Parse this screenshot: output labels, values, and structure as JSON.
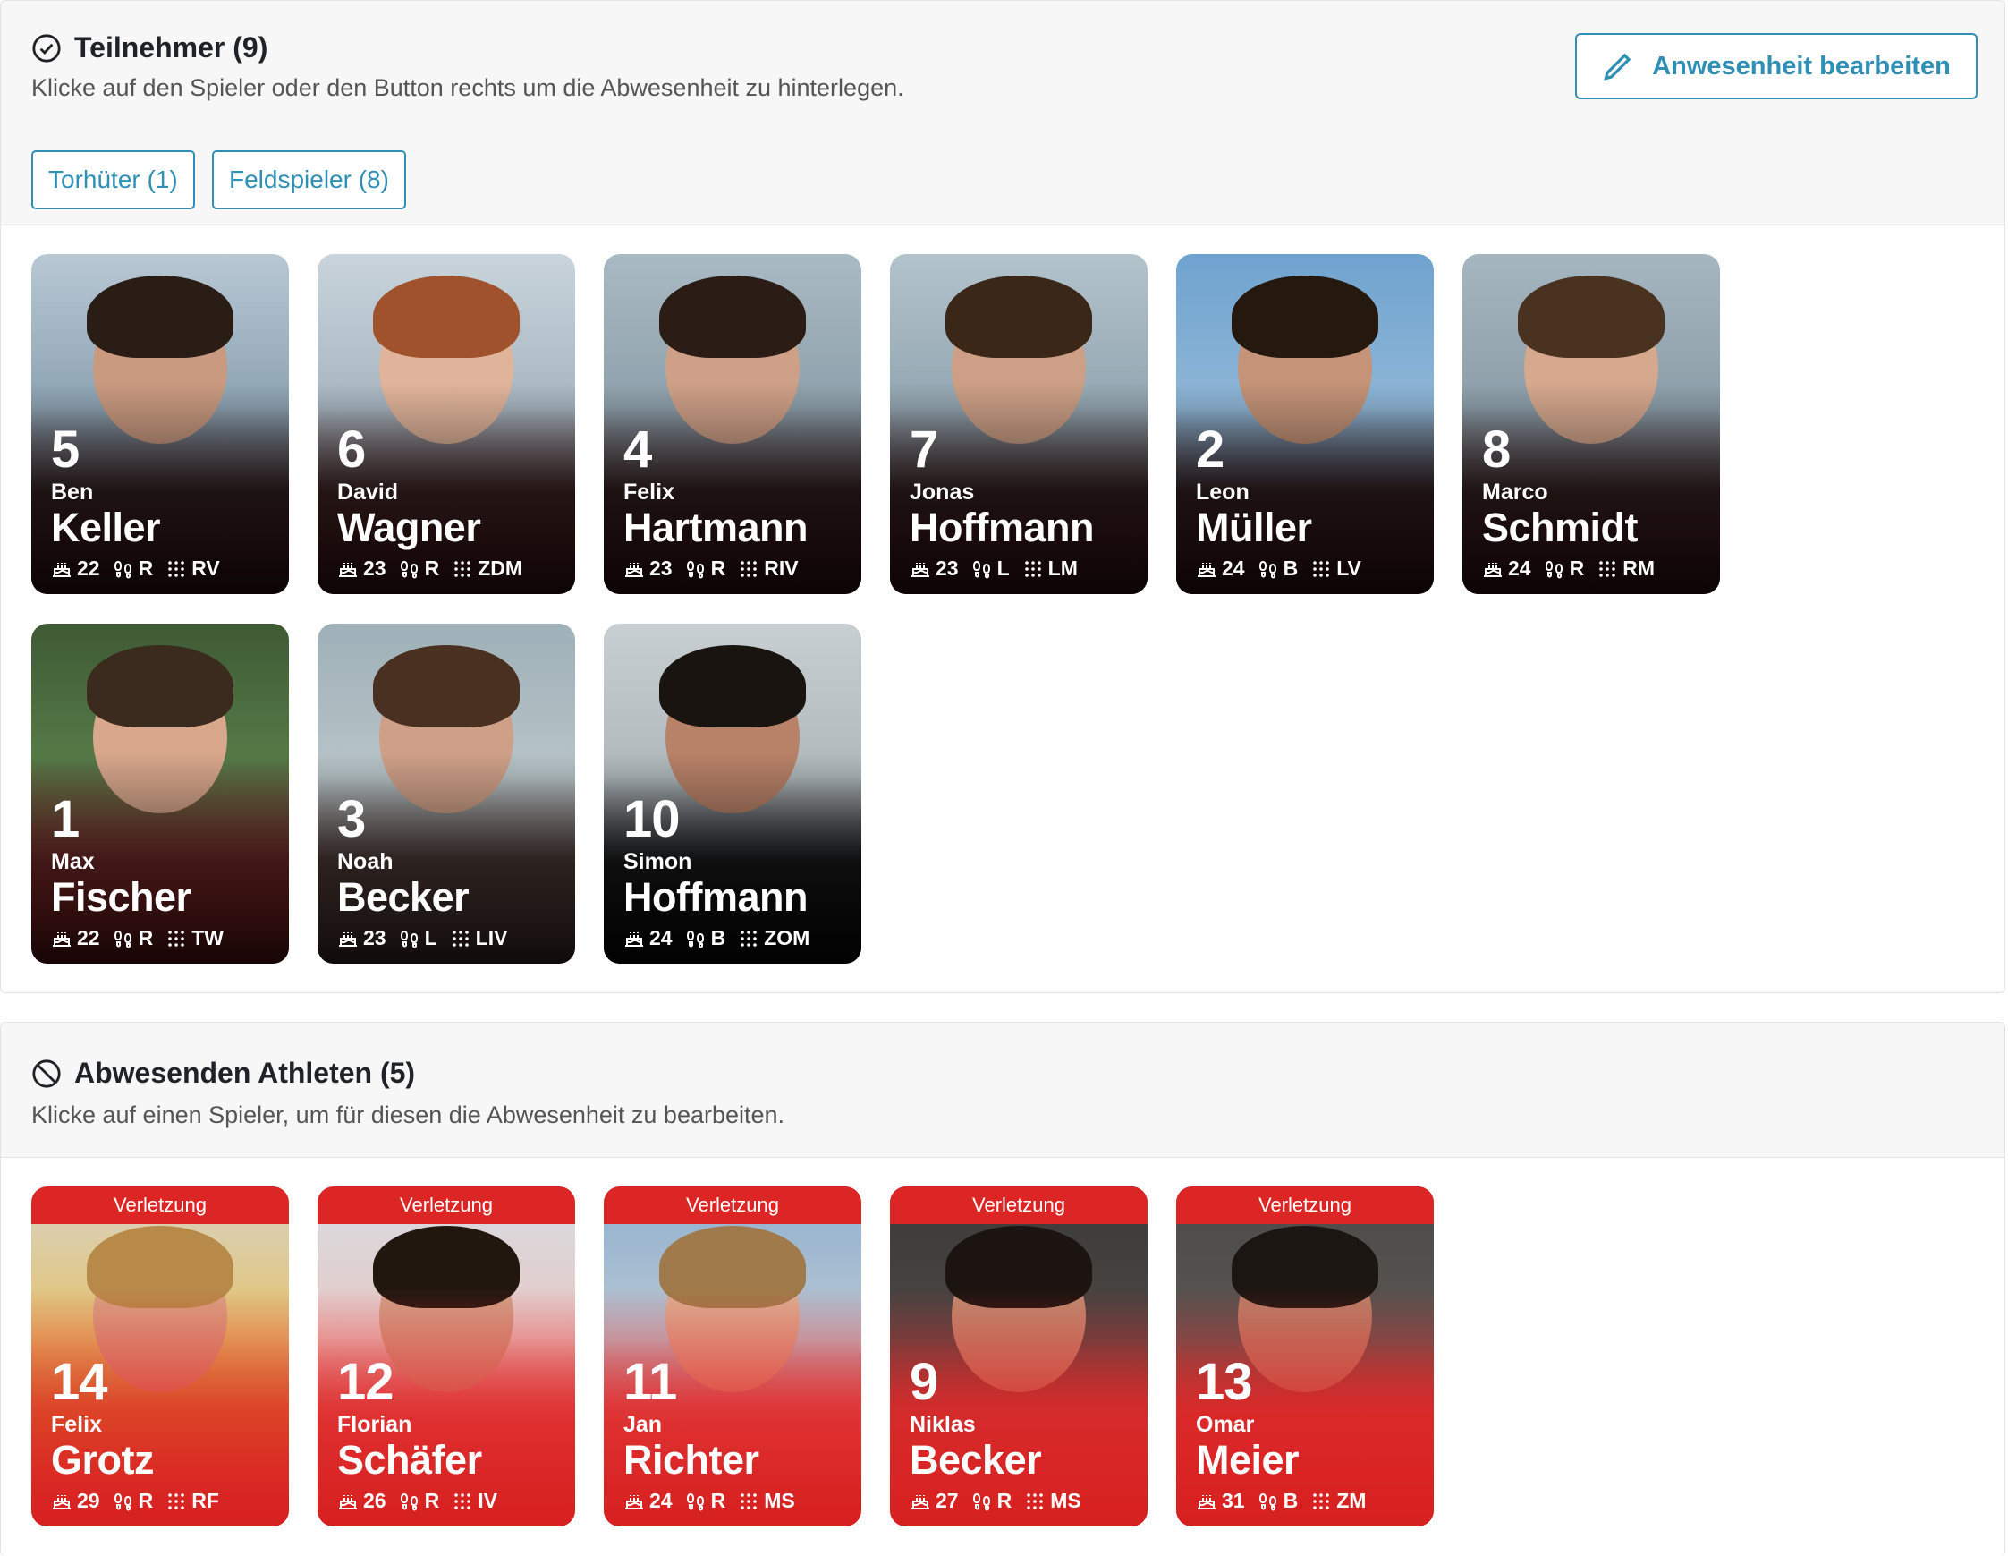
{
  "participants": {
    "title": "Teilnehmer (9)",
    "subtitle": "Klicke auf den Spieler oder den Button rechts um die Abwesenheit zu hinterlegen.",
    "edit_button": "Anwesenheit bearbeiten",
    "filters": [
      "Torhüter (1)",
      "Feldspieler (8)"
    ],
    "players": [
      {
        "number": "5",
        "first": "Ben",
        "last": "Keller",
        "age": "22",
        "foot": "R",
        "pos": "RV"
      },
      {
        "number": "6",
        "first": "David",
        "last": "Wagner",
        "age": "23",
        "foot": "R",
        "pos": "ZDM"
      },
      {
        "number": "4",
        "first": "Felix",
        "last": "Hartmann",
        "age": "23",
        "foot": "R",
        "pos": "RIV"
      },
      {
        "number": "7",
        "first": "Jonas",
        "last": "Hoffmann",
        "age": "23",
        "foot": "L",
        "pos": "LM"
      },
      {
        "number": "2",
        "first": "Leon",
        "last": "Müller",
        "age": "24",
        "foot": "B",
        "pos": "LV"
      },
      {
        "number": "8",
        "first": "Marco",
        "last": "Schmidt",
        "age": "24",
        "foot": "R",
        "pos": "RM"
      },
      {
        "number": "1",
        "first": "Max",
        "last": "Fischer",
        "age": "22",
        "foot": "R",
        "pos": "TW"
      },
      {
        "number": "3",
        "first": "Noah",
        "last": "Becker",
        "age": "23",
        "foot": "L",
        "pos": "LIV"
      },
      {
        "number": "10",
        "first": "Simon",
        "last": "Hoffmann",
        "age": "24",
        "foot": "B",
        "pos": "ZOM"
      }
    ]
  },
  "absent": {
    "title": "Abwesenden Athleten (5)",
    "subtitle": "Klicke auf einen Spieler, um für diesen die Abwesenheit zu bearbeiten.",
    "players": [
      {
        "badge": "Verletzung",
        "number": "14",
        "first": "Felix",
        "last": "Grotz",
        "age": "29",
        "foot": "R",
        "pos": "RF"
      },
      {
        "badge": "Verletzung",
        "number": "12",
        "first": "Florian",
        "last": "Schäfer",
        "age": "26",
        "foot": "R",
        "pos": "IV"
      },
      {
        "badge": "Verletzung",
        "number": "11",
        "first": "Jan",
        "last": "Richter",
        "age": "24",
        "foot": "R",
        "pos": "MS"
      },
      {
        "badge": "Verletzung",
        "number": "9",
        "first": "Niklas",
        "last": "Becker",
        "age": "27",
        "foot": "R",
        "pos": "MS"
      },
      {
        "badge": "Verletzung",
        "number": "13",
        "first": "Omar",
        "last": "Meier",
        "age": "31",
        "foot": "B",
        "pos": "ZM"
      }
    ]
  },
  "colors": {
    "accent": "#2f8fb5",
    "injury": "#dc2626"
  },
  "icons": [
    "check-circle-icon",
    "pencil-icon",
    "ban-icon",
    "cake-icon",
    "footprints-icon",
    "grid-icon"
  ]
}
